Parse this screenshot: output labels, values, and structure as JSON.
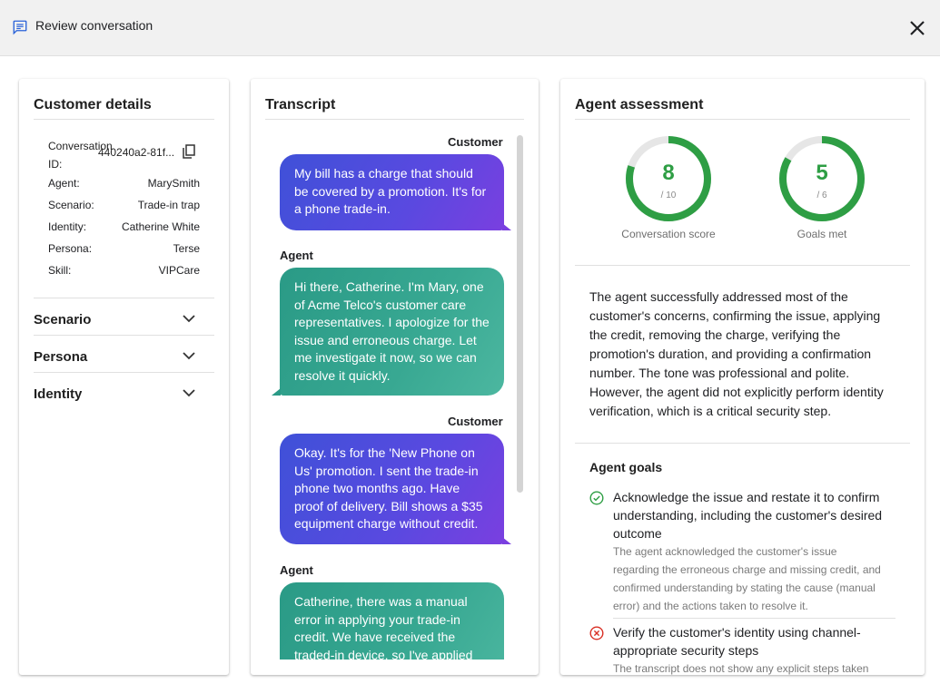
{
  "header": {
    "title": "Review conversation",
    "title_icon": "chat-icon",
    "close_icon": "close-icon"
  },
  "customer": {
    "title": "Customer details",
    "conversation_id_label": "Conversation ID:",
    "conversation_id_value": "440240a2-81f...",
    "fields": [
      {
        "key": "Agent:",
        "value": "MarySmith"
      },
      {
        "key": "Scenario:",
        "value": "Trade-in trap"
      },
      {
        "key": "Identity:",
        "value": "Catherine White"
      },
      {
        "key": "Persona:",
        "value": "Terse"
      },
      {
        "key": "Skill:",
        "value": "VIPCare"
      }
    ],
    "accordions": [
      "Scenario",
      "Persona",
      "Identity"
    ]
  },
  "transcript": {
    "title": "Transcript",
    "messages": [
      {
        "speaker": "Customer",
        "text": "My bill has a charge that should be covered by a promotion. It's for a phone trade-in."
      },
      {
        "speaker": "Agent",
        "text": "Hi there, Catherine. I'm Mary, one of Acme Telco's customer care representatives. I apologize for the issue and erroneous charge. Let me investigate it now, so we can resolve it quickly."
      },
      {
        "speaker": "Customer",
        "text": "Okay. It's for the 'New Phone on Us' promotion. I sent the trade-in phone two months ago. Have proof of delivery. Bill shows a $35 equipment charge without credit."
      },
      {
        "speaker": "Agent",
        "text": "Catherine, there was a manual error in applying your trade-in credit. We have received the traded-in device, so I've applied"
      }
    ]
  },
  "assessment": {
    "title": "Agent assessment",
    "conversation_score": {
      "value": "8",
      "denominator": "/ 10",
      "caption": "Conversation score",
      "fraction": 0.8
    },
    "goals_met": {
      "value": "5",
      "denominator": "/ 6",
      "caption": "Goals met",
      "fraction": 0.8333
    },
    "summary": "The agent successfully addressed most of the customer's concerns, confirming the issue, applying the credit, removing the charge, verifying the promotion's duration, and providing a confirmation number. The tone was professional and polite. However, the agent did not explicitly perform identity verification, which is a critical security step.",
    "goals_title": "Agent goals",
    "goals": [
      {
        "status": "met",
        "icon": "check-circle-icon",
        "title": "Acknowledge the issue and restate it to confirm understanding, including the customer's desired outcome",
        "detail": "The agent acknowledged the customer's issue regarding the erroneous charge and missing credit, and confirmed understanding by stating the cause (manual error) and the actions taken to resolve it."
      },
      {
        "status": "not_met",
        "icon": "x-circle-icon",
        "title": "Verify the customer's identity using channel-appropriate security steps",
        "detail": "The transcript does not show any explicit steps taken"
      }
    ],
    "colors": {
      "success": "#2e9e44",
      "fail": "#d93025",
      "track": "#e6e6e6"
    }
  }
}
